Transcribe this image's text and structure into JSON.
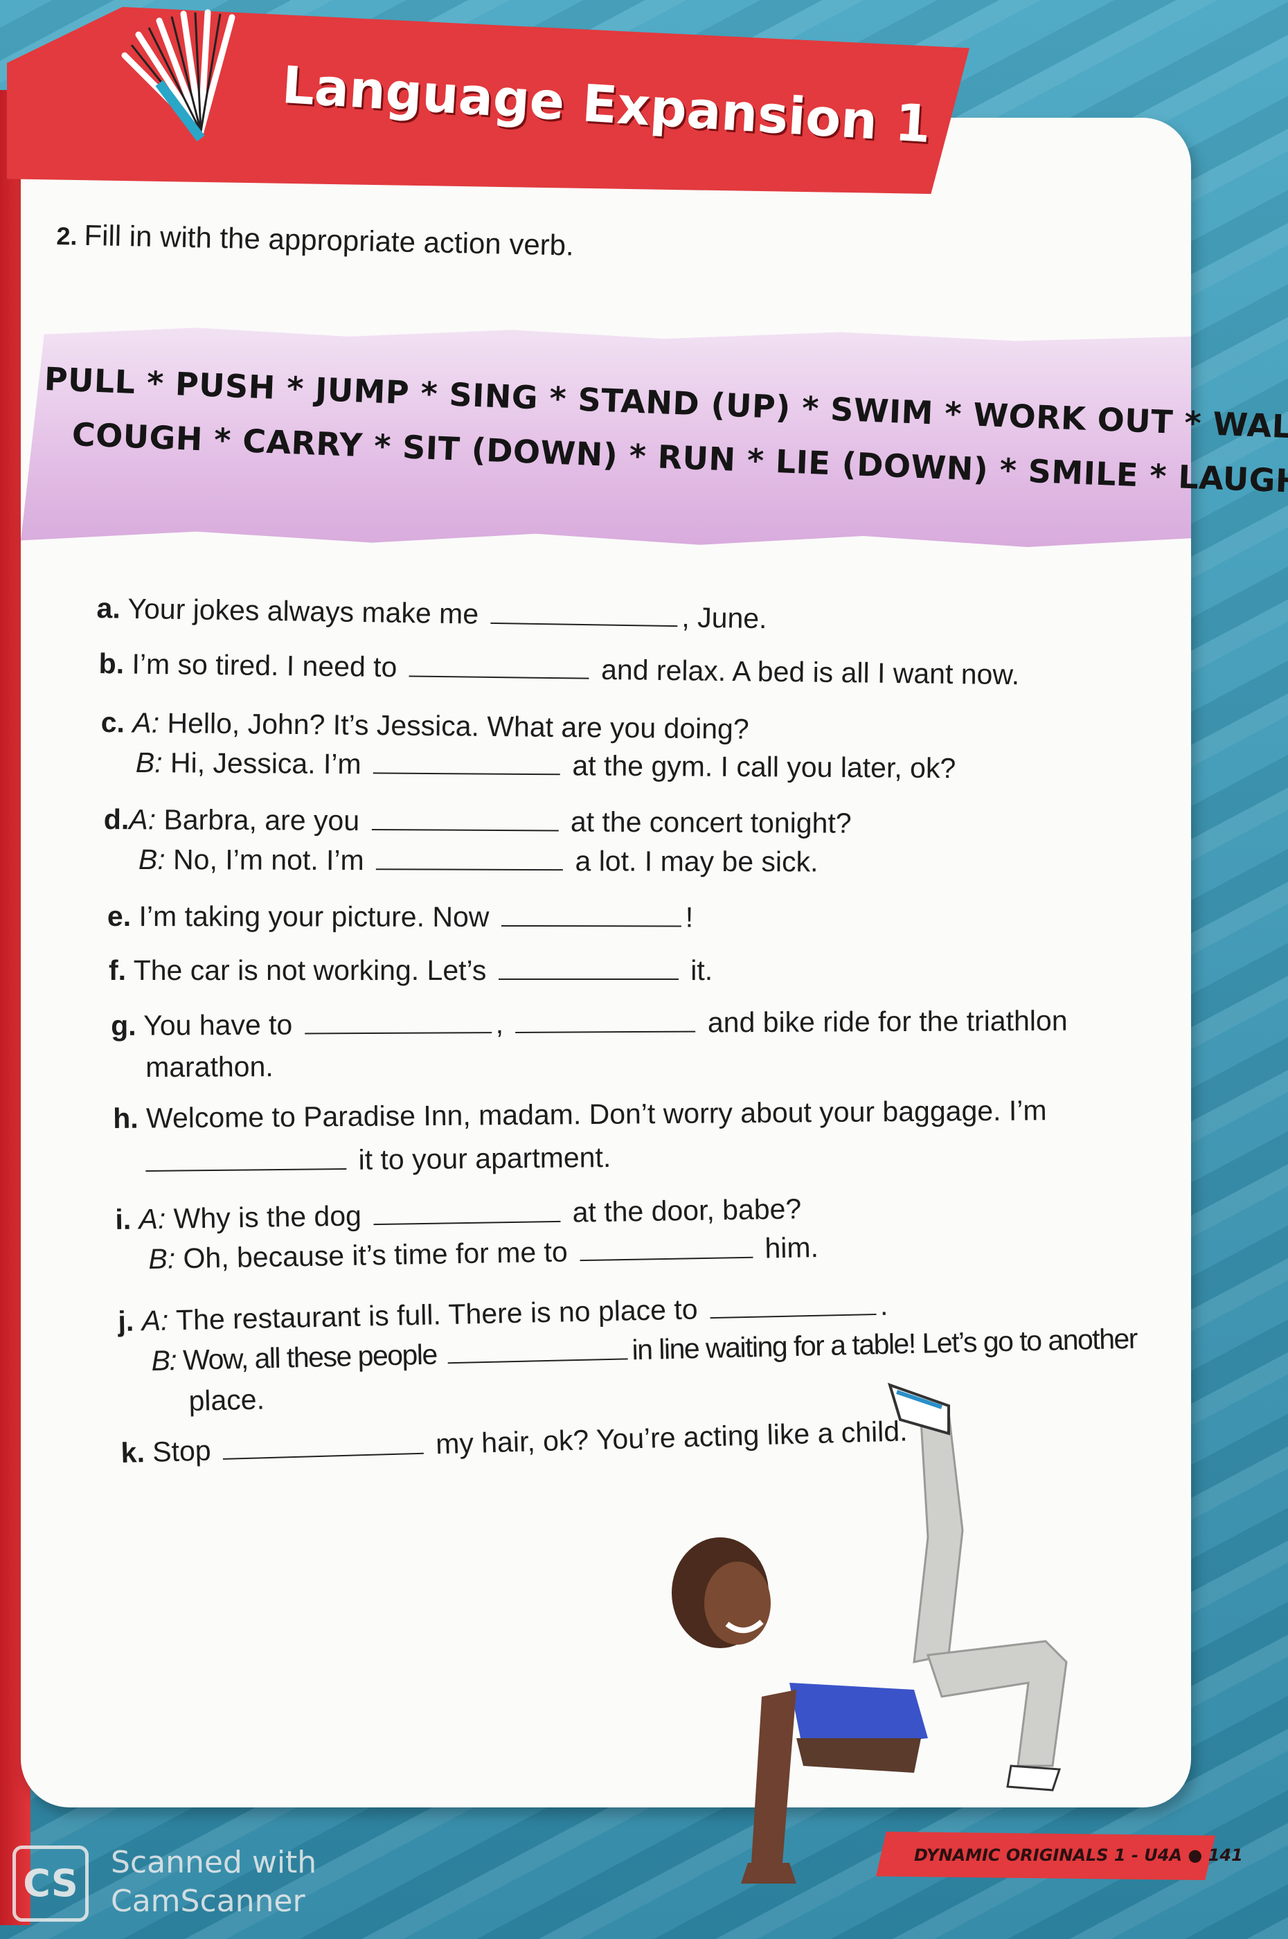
{
  "header": {
    "title": "Language Expansion 1"
  },
  "instruction": {
    "number": "2.",
    "text": "Fill in with the appropriate action verb."
  },
  "word_bank": {
    "line1": "PULL * PUSH * JUMP * SING * STAND (UP) * SWIM * WORK OUT * WALK",
    "line2": "COUGH * CARRY * SIT (DOWN) * RUN * LIE (DOWN) * SMILE * LAUGH"
  },
  "exercises": {
    "a": {
      "letter": "a.",
      "p1": "Your jokes always make me",
      "p2": ", June."
    },
    "b": {
      "letter": "b.",
      "p1": "I’m so tired. I need to",
      "p2": "and relax. A bed is all I want now."
    },
    "c": {
      "letter": "c.",
      "a_speaker": "A:",
      "a_text": "Hello, John? It’s Jessica. What are you doing?",
      "b_speaker": "B:",
      "b_p1": "Hi, Jessica. I’m",
      "b_p2": "at the gym. I call you later, ok?"
    },
    "d": {
      "letter": "d.",
      "a_speaker": "A:",
      "a_p1": "Barbra, are you",
      "a_p2": "at the concert tonight?",
      "b_speaker": "B:",
      "b_p1": "No, I’m not. I’m",
      "b_p2": "a lot. I may be sick."
    },
    "e": {
      "letter": "e.",
      "p1": "I’m taking your picture. Now",
      "p2": "!"
    },
    "f": {
      "letter": "f.",
      "p1": "The car is not working. Let’s",
      "p2": "it."
    },
    "g": {
      "letter": "g.",
      "p1": "You have to",
      "p2": ",",
      "p3": "and bike ride for the triathlon",
      "p4": "marathon."
    },
    "h": {
      "letter": "h.",
      "p1": "Welcome to Paradise Inn, madam. Don’t worry about your baggage. I’m",
      "p2": "it to your apartment."
    },
    "i": {
      "letter": "i.",
      "a_speaker": "A:",
      "a_p1": "Why is the dog",
      "a_p2": "at the door, babe?",
      "b_speaker": "B:",
      "b_p1": "Oh, because it’s time for me to",
      "b_p2": "him."
    },
    "j": {
      "letter": "j.",
      "a_speaker": "A:",
      "a_p1": "The restaurant is full. There is no place to",
      "a_p2": ".",
      "b_speaker": "B:",
      "b_p1": "Wow, all these people",
      "b_p2": "in line waiting for a table! Let’s go to another",
      "b_p3": "place."
    },
    "k": {
      "letter": "k.",
      "p1": "Stop",
      "p2": "my hair, ok? You’re acting like a child."
    }
  },
  "footer": {
    "text": "DYNAMIC ORIGINALS 1 - U4A ● 141"
  },
  "watermark": {
    "logo": "CS",
    "line1": "Scanned with",
    "line2": "CamScanner"
  },
  "colors": {
    "banner_red": "#e23a3e",
    "word_bank_purple": "#e3bfe6",
    "background_teal": "#3f9bb8"
  }
}
